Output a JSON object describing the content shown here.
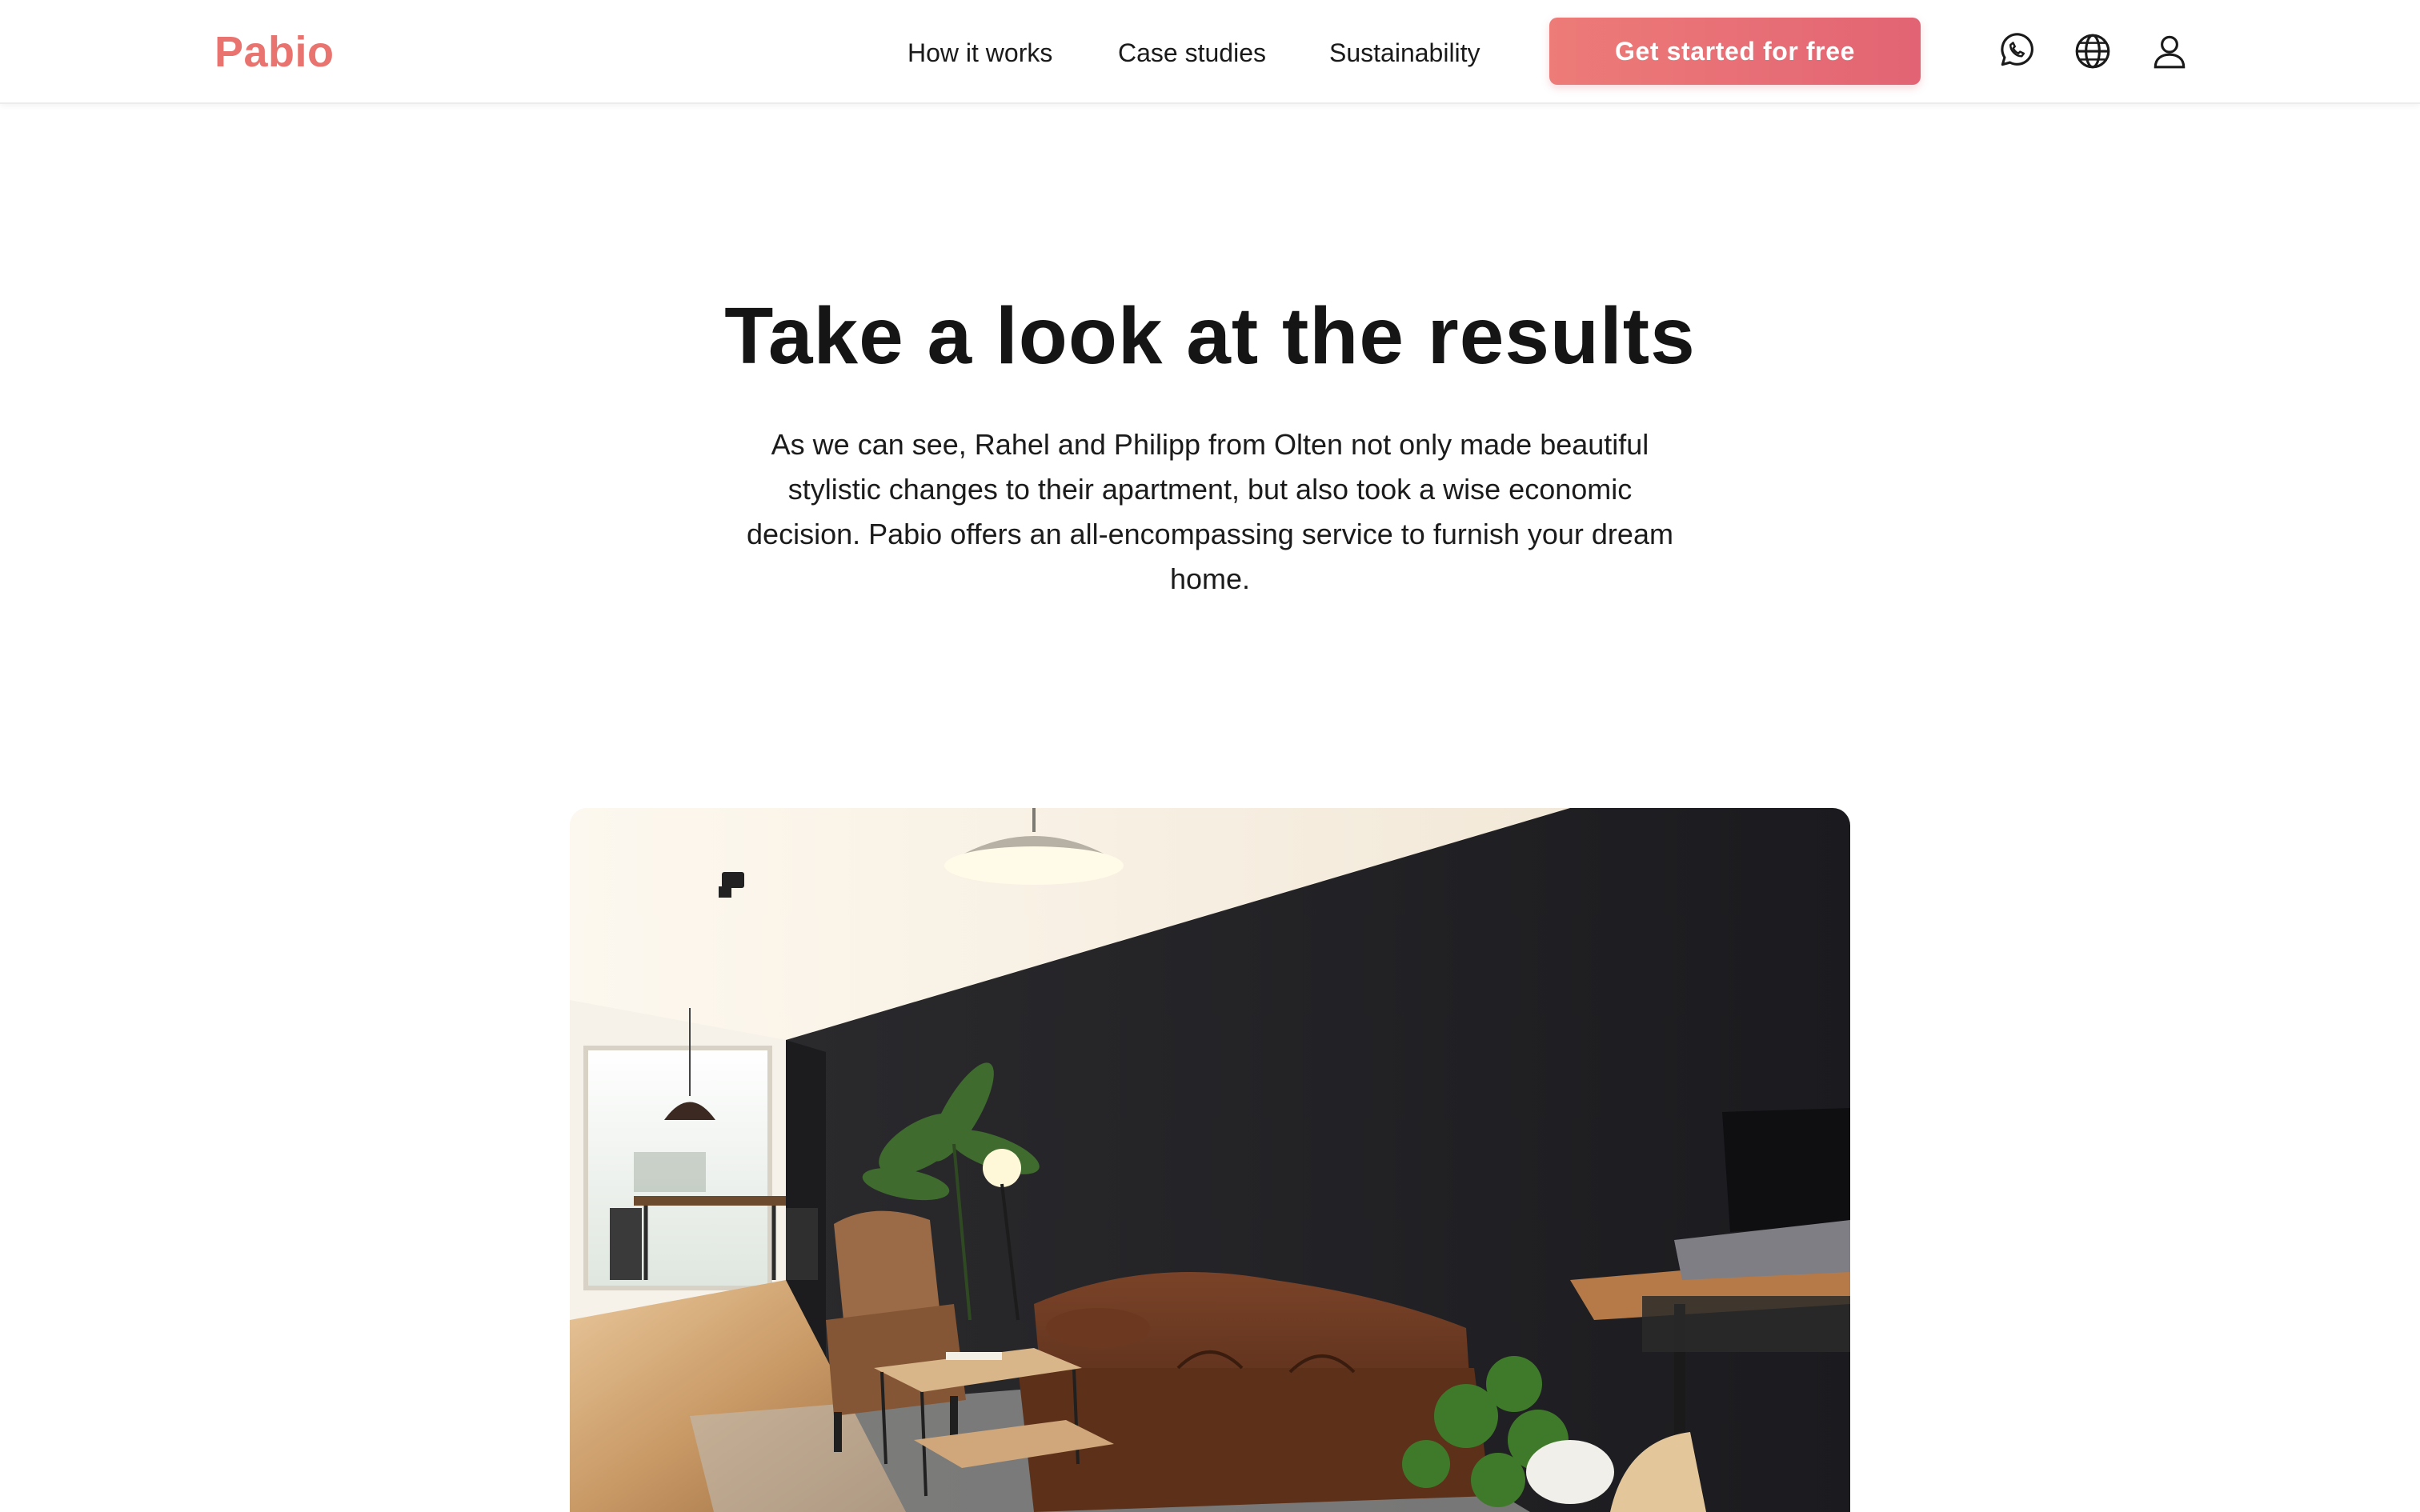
{
  "header": {
    "logo": "Pabio",
    "nav": [
      {
        "label": "How it works"
      },
      {
        "label": "Case studies"
      },
      {
        "label": "Sustainability"
      }
    ],
    "cta_label": "Get started for free",
    "icons": [
      "whatsapp-icon",
      "globe-icon",
      "user-icon"
    ]
  },
  "main": {
    "headline": "Take a look at the results",
    "description": "As we can see, Rahel and Philipp from Olten not only made beautiful stylistic changes to their apartment, but also took a wise economic decision. Pabio offers an all-encompassing service to furnish your dream home."
  },
  "colors": {
    "brand": "#e8736f",
    "cta_gradient_start": "#ed7b77",
    "cta_gradient_end": "#e26474",
    "text": "#141414"
  }
}
